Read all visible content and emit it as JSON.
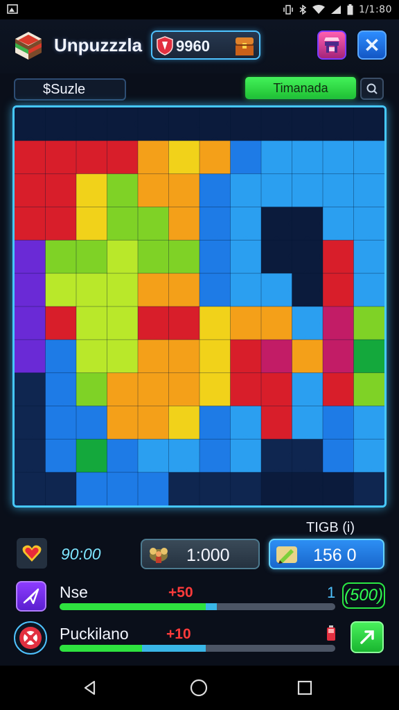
{
  "status_bar": {
    "time": "1/1:80"
  },
  "header": {
    "title": "Unpuzzzla",
    "coins": "9960",
    "colors": {
      "accent": "#46c8ff",
      "brand": "#eef4ff"
    }
  },
  "subheader": {
    "puzzle_label": "$Suzle",
    "mode_button": "Timanada"
  },
  "board": {
    "columns": 12,
    "rows": 12
  },
  "stats": {
    "caption": "TIGB (i)",
    "timer": "90:00",
    "score": "1:000",
    "gems": "156  0"
  },
  "rows": [
    {
      "label": "Nse",
      "delta": "+50",
      "rank": "1",
      "reward": "(500)",
      "progress": 0.53,
      "progress_accent": 0.04
    },
    {
      "label": "Puckilano",
      "delta": "+10",
      "progress": 0.3,
      "progress_accent": 0.23
    }
  ],
  "colors": {
    "progress_green": "#2ee23f",
    "progress_blue": "#39b6e6",
    "delta_red": "#ff3b3b"
  }
}
